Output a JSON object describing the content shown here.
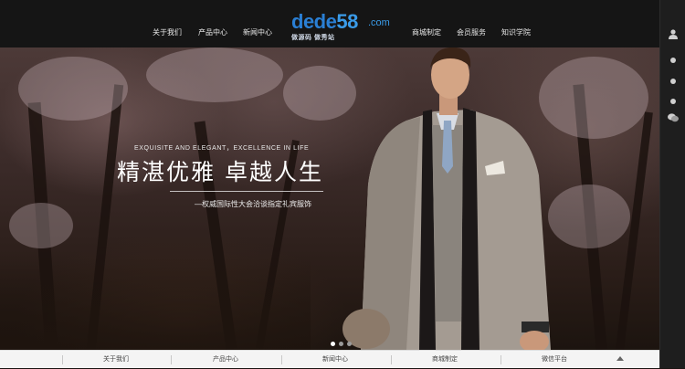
{
  "nav": {
    "left": [
      "关于我们",
      "产品中心",
      "新闻中心"
    ],
    "right": [
      "商城制定",
      "会员服务",
      "知识学院"
    ]
  },
  "logo": {
    "brand": "dede",
    "number": "58",
    "suffix": ".com",
    "tagline": "做源码 做秀站"
  },
  "hero": {
    "en": "EXQUISITE AND ELEGANT，EXCELLENCE IN LIFE",
    "cn": "精湛优雅 卓越人生",
    "sub": "—权威国际性大会洽谈指定礼宾服饰",
    "slides": 3,
    "active_slide": 1
  },
  "bottombar": {
    "items": [
      "关于我们",
      "产品中心",
      "新闻中心",
      "商城制定",
      "微信平台"
    ]
  },
  "sidebar": {
    "icons": [
      "user-icon",
      "dot-icon",
      "dot-icon",
      "dot-icon",
      "wechat-icon"
    ]
  },
  "colors": {
    "nav_bg": "#151515",
    "logo_blue": "#2a7fd4",
    "bottom_bg": "#f4f4f4"
  }
}
